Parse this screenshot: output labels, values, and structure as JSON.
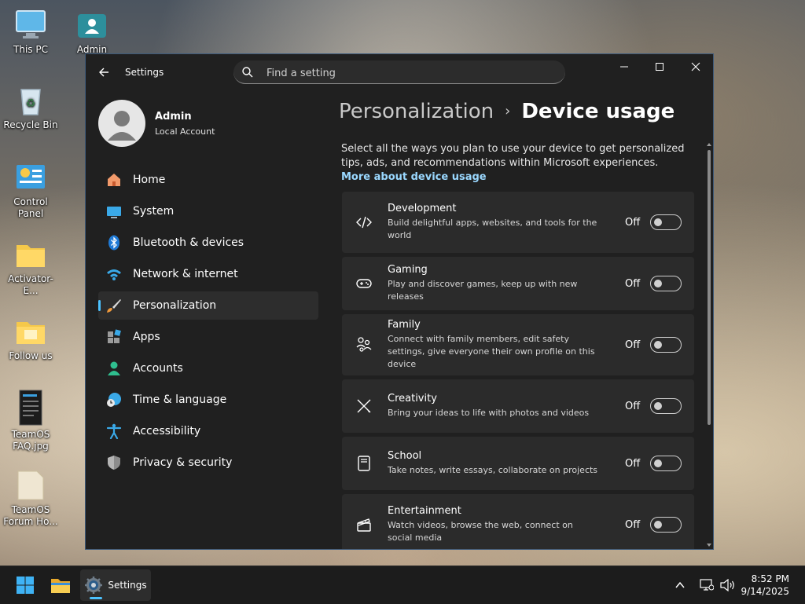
{
  "desktop": {
    "icons": [
      {
        "label": "This PC"
      },
      {
        "label": "Admin"
      },
      {
        "label": "Recycle Bin"
      },
      {
        "label": "Control Panel"
      },
      {
        "label": "Activator-E..."
      },
      {
        "label": "Follow us"
      },
      {
        "label": "TeamOS FAQ.jpg"
      },
      {
        "label": "TeamOS Forum Ho..."
      }
    ]
  },
  "window": {
    "app_title": "Settings",
    "search_placeholder": "Find a setting"
  },
  "profile": {
    "name": "Admin",
    "account_type": "Local Account"
  },
  "nav": {
    "items": [
      {
        "label": "Home",
        "icon": "home-icon"
      },
      {
        "label": "System",
        "icon": "monitor-icon"
      },
      {
        "label": "Bluetooth & devices",
        "icon": "bluetooth-icon"
      },
      {
        "label": "Network & internet",
        "icon": "wifi-icon"
      },
      {
        "label": "Personalization",
        "icon": "paintbrush-icon",
        "active": true
      },
      {
        "label": "Apps",
        "icon": "apps-icon"
      },
      {
        "label": "Accounts",
        "icon": "person-icon"
      },
      {
        "label": "Time & language",
        "icon": "globe-clock-icon"
      },
      {
        "label": "Accessibility",
        "icon": "accessibility-icon"
      },
      {
        "label": "Privacy & security",
        "icon": "shield-icon"
      }
    ]
  },
  "page": {
    "breadcrumb_parent": "Personalization",
    "breadcrumb_separator": "›",
    "title": "Device usage",
    "intro": "Select all the ways you plan to use your device to get personalized tips, ads, and recommendations within Microsoft experiences. ",
    "intro_link": "More about device usage"
  },
  "usage_items": [
    {
      "title": "Development",
      "description": "Build delightful apps, websites, and tools for the world",
      "state": "Off",
      "icon": "code-icon"
    },
    {
      "title": "Gaming",
      "description": "Play and discover games, keep up with new releases",
      "state": "Off",
      "icon": "gamepad-icon"
    },
    {
      "title": "Family",
      "description": "Connect with family members, edit safety settings, give everyone their own profile on this device",
      "state": "Off",
      "icon": "family-icon"
    },
    {
      "title": "Creativity",
      "description": "Bring your ideas to life with photos and videos",
      "state": "Off",
      "icon": "pen-brush-icon"
    },
    {
      "title": "School",
      "description": "Take notes, write essays, collaborate on projects",
      "state": "Off",
      "icon": "notebook-icon"
    },
    {
      "title": "Entertainment",
      "description": "Watch videos, browse the web, connect on social media",
      "state": "Off",
      "icon": "clapperboard-icon"
    }
  ],
  "taskbar": {
    "app_label": "Settings",
    "time": "8:52 PM",
    "date": "9/14/2025"
  },
  "colors": {
    "accent": "#4cc2ff",
    "link": "#9ad8ff",
    "window_bg": "#202020",
    "card_bg": "#2b2b2b"
  }
}
